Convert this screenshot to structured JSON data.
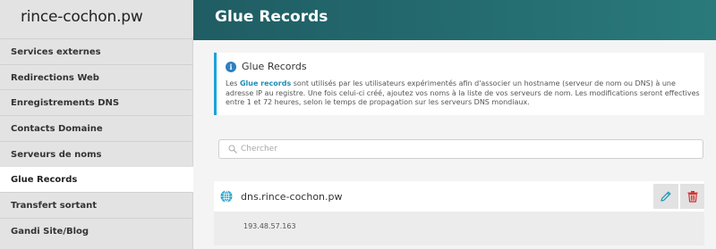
{
  "sidebar": {
    "domain": "rince-cochon.pw",
    "items": [
      {
        "label": "Services externes"
      },
      {
        "label": "Redirections Web"
      },
      {
        "label": "Enregistrements DNS"
      },
      {
        "label": "Contacts Domaine"
      },
      {
        "label": "Serveurs de noms"
      },
      {
        "label": "Glue Records",
        "active": true
      },
      {
        "label": "Transfert sortant"
      },
      {
        "label": "Gandi Site/Blog"
      }
    ]
  },
  "header": {
    "title": "Glue Records"
  },
  "info": {
    "icon": "info-icon",
    "title": "Glue Records",
    "text_prefix": "Les ",
    "link": "Glue records",
    "text_suffix": " sont utilisés par les utilisateurs expérimentés afin d'associer un hostname (serveur de nom ou DNS) à une adresse IP au registre. Une fois celui-ci créé, ajoutez vos noms à la liste de vos serveurs de nom. Les modifications seront effectives entre 1 et 72 heures, selon le temps de propagation sur les serveurs DNS mondiaux."
  },
  "search": {
    "placeholder": "Chercher",
    "value": ""
  },
  "records": [
    {
      "name": "dns.rince-cochon.pw",
      "ip": "193.48.57.163"
    }
  ],
  "colors": {
    "header_start": "#1f5d63",
    "header_end": "#2a7a7b",
    "accent_blue": "#1ca3d7",
    "link": "#1c8fb8",
    "edit_icon": "#1b98b5",
    "delete_icon": "#d32f2f",
    "globe": "#18a0c8"
  }
}
